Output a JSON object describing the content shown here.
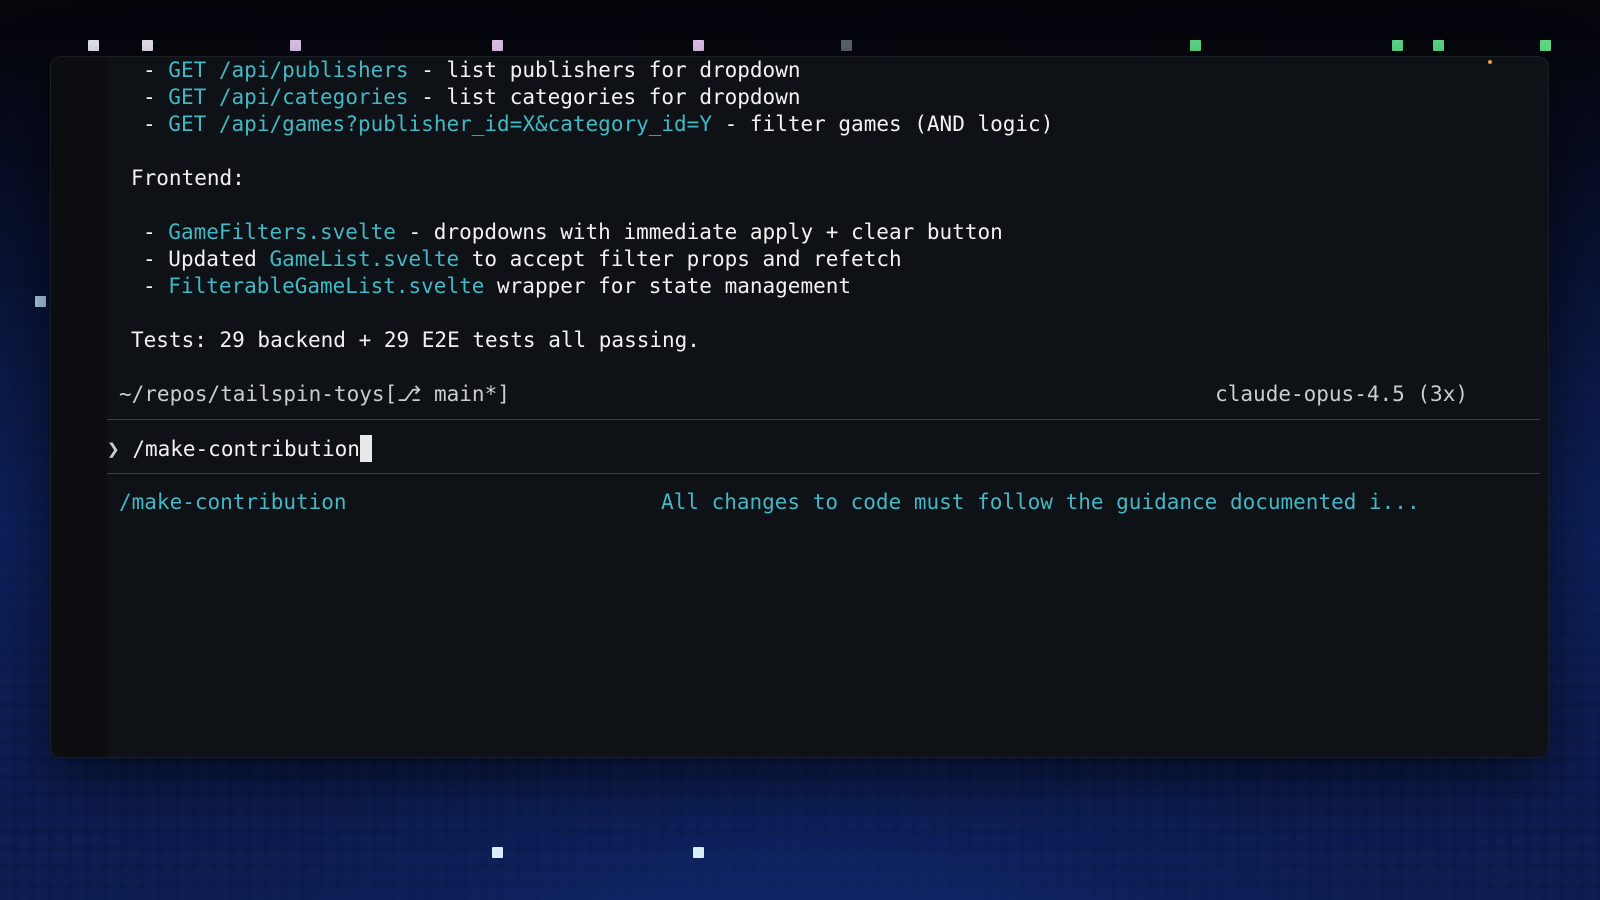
{
  "output": {
    "api_items": [
      {
        "prefix": "- ",
        "method": "GET",
        "path": "/api/publishers",
        "desc": " - list publishers for dropdown"
      },
      {
        "prefix": "- ",
        "method": "GET",
        "path": "/api/categories",
        "desc": " - list categories for dropdown"
      },
      {
        "prefix": "- ",
        "method": "GET",
        "path": "/api/games?publisher_id=X&category_id=Y",
        "desc": " - filter games (AND logic)"
      }
    ],
    "frontend_heading": "Frontend:",
    "frontend_items": [
      {
        "prefix": "- ",
        "before": "",
        "file": "GameFilters.svelte",
        "after": " - dropdowns with immediate apply + clear button"
      },
      {
        "prefix": "- ",
        "before": "Updated ",
        "file": "GameList.svelte",
        "after": " to accept filter props and refetch"
      },
      {
        "prefix": "- ",
        "before": "",
        "file": "FilterableGameList.svelte",
        "after": " wrapper for state management"
      }
    ],
    "tests_summary": "Tests: 29 backend + 29 E2E tests all passing."
  },
  "status_bar": {
    "path": "~/repos/tailspin-toys",
    "branch": "[⎇ main*]",
    "model": "claude-opus-4.5 (3x)"
  },
  "prompt": {
    "symbol": "❯",
    "input_value": "/make-contribution"
  },
  "suggestion": {
    "command": "/make-contribution",
    "description": "All changes to code must follow the guidance documented i..."
  },
  "colors": {
    "accent_cyan": "#42b8c4",
    "text": "#f2f2f2",
    "terminal_bg": "#0e1116"
  }
}
